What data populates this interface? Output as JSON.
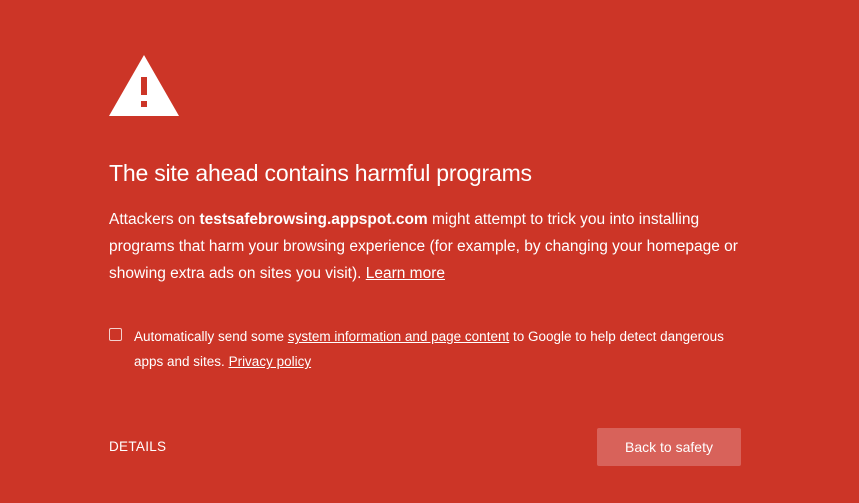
{
  "warning": {
    "icon": "warning-triangle-icon",
    "heading": "The site ahead contains harmful programs"
  },
  "message": {
    "prefix": "Attackers on ",
    "domain": "testsafebrowsing.appspot.com",
    "body": " might attempt to trick you into installing programs that harm your browsing experience (for example, by changing your homepage or showing extra ads on sites you visit). ",
    "learn_more": "Learn more"
  },
  "report": {
    "checked": false,
    "prefix": "Automatically send some ",
    "link_text": "system information and page content",
    "middle": " to Google to help detect dangerous apps and sites. ",
    "privacy_link": "Privacy policy"
  },
  "actions": {
    "details_label": "DETAILS",
    "back_label": "Back to safety"
  },
  "colors": {
    "background": "#cc3527",
    "button": "#d8625a",
    "text": "#ffffff"
  }
}
